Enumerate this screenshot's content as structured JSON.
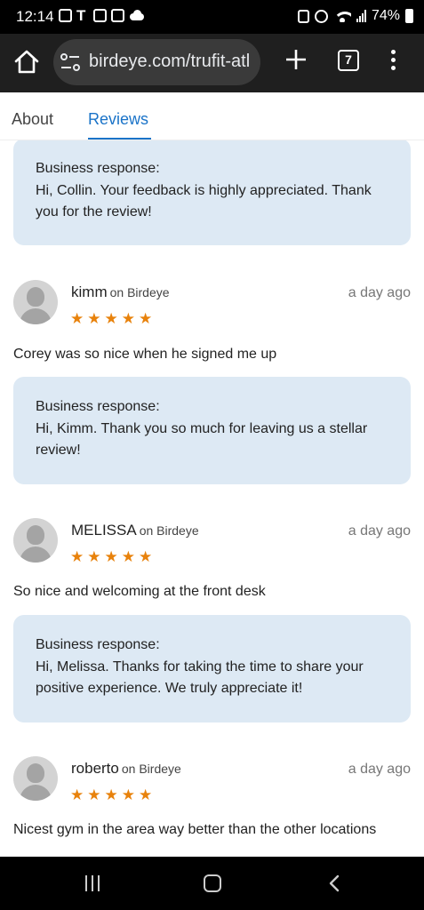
{
  "status_bar": {
    "time": "12:14",
    "battery": "74%",
    "icons": [
      "notification-icon",
      "t-mobile-icon",
      "gallery-icon",
      "news-icon",
      "cloud-icon",
      "battery-saver-icon",
      "alarm-icon",
      "wifi-icon",
      "signal-icon",
      "battery-icon"
    ]
  },
  "browser": {
    "url": "birdeye.com/trufit-atl",
    "tab_count": "7",
    "icons": [
      "home-icon",
      "site-settings-icon",
      "new-tab-icon",
      "tab-switcher-icon",
      "more-menu-icon"
    ]
  },
  "tabs": [
    {
      "label": "About",
      "active": false
    },
    {
      "label": "Reviews",
      "active": true
    }
  ],
  "accent_color": "#1a73c8",
  "star_color": "#e8820c",
  "response_bg": "#dde9f4",
  "top_response": {
    "label": "Business response:",
    "text": "Hi, Collin. Your feedback is highly appreciated. Thank you for the review!"
  },
  "reviews": [
    {
      "name": "kimm",
      "platform": "on Birdeye",
      "time": "a day ago",
      "rating": 5,
      "stars": "★★★★★",
      "text": "Corey was so nice when he signed me up",
      "response_label": "Business response:",
      "response": "Hi, Kimm. Thank you so much for leaving us a stellar review!"
    },
    {
      "name": "MELISSA",
      "platform": "on Birdeye",
      "time": "a day ago",
      "rating": 5,
      "stars": "★★★★★",
      "text": "So nice and welcoming at the front desk",
      "response_label": "Business response:",
      "response": "Hi, Melissa. Thanks for taking the time to share your positive experience. We truly appreciate it!"
    },
    {
      "name": "roberto",
      "platform": "on Birdeye",
      "time": "a day ago",
      "rating": 5,
      "stars": "★★★★★",
      "text": "Nicest gym in the area way better than the other locations"
    }
  ],
  "nav_bar": {
    "icons": [
      "recent-apps-icon",
      "home-button-icon",
      "back-icon"
    ]
  }
}
